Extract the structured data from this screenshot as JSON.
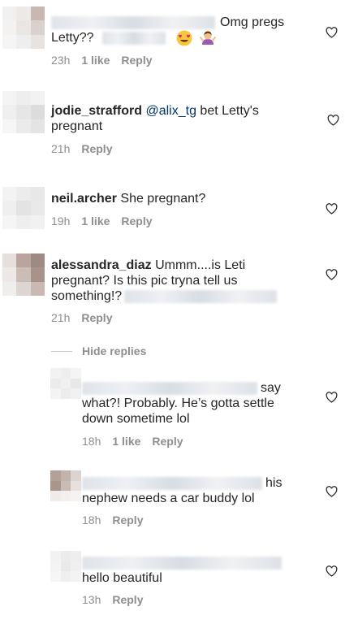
{
  "comments": [
    {
      "username_hidden": true,
      "text_a": "Omg pregs",
      "text_b": "Letty??",
      "time": "23h",
      "likes": "1 like",
      "reply": "Reply",
      "emoji": [
        "smiling-face-heart-eyes",
        "woman-shrugging"
      ]
    },
    {
      "username": "jodie_strafford",
      "mention": "@alix_tg",
      "text_a": "bet Letty's",
      "text_b": "pregnant",
      "time": "21h",
      "reply": "Reply"
    },
    {
      "username": "neil.archer",
      "text_a": "She pregnant?",
      "time": "19h",
      "likes": "1 like",
      "reply": "Reply"
    },
    {
      "username": "alessandra_diaz",
      "text_a": "Ummm....is Leti",
      "text_b": "pregnant? Is this pic tryna tell us",
      "text_c": "something!?",
      "time": "21h",
      "reply": "Reply"
    }
  ],
  "hide_replies": "Hide replies",
  "replies": [
    {
      "text_a": "say",
      "text_b": "what?! Probably. He’s gotta settle",
      "text_c": "down sometime lol",
      "time": "18h",
      "likes": "1 like",
      "reply": "Reply"
    },
    {
      "text_a": "his",
      "text_b": "nephew needs a car buddy lol",
      "time": "18h",
      "reply": "Reply"
    },
    {
      "text_a": "hello beautiful",
      "time": "13h",
      "reply": "Reply"
    }
  ],
  "icons": {
    "like": "heart-outline-icon"
  },
  "colors": {
    "text": "#262626",
    "muted": "#8e8e8e",
    "mention": "#003569"
  }
}
